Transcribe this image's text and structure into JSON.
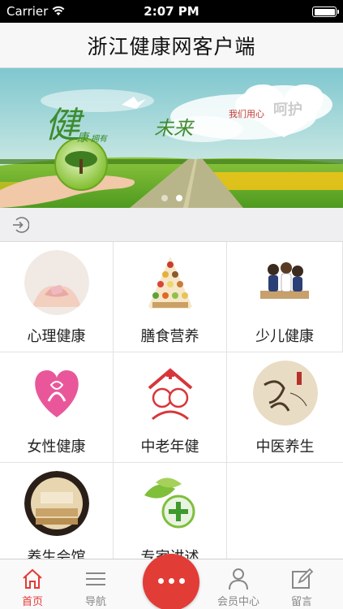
{
  "status_bar": {
    "carrier": "Carrier",
    "time": "2:07 PM"
  },
  "header": {
    "title": "浙江健康网客户端"
  },
  "banner": {
    "text_left_big": "健",
    "text_left_small": "康",
    "text_left_sub": "拥有",
    "text_future": "未来",
    "text_right_small": "我们用心",
    "text_right_big": "呵护",
    "page_count": 2,
    "active_page": 2
  },
  "notice": {
    "icon": "login-icon"
  },
  "categories": [
    {
      "label": "心理健康",
      "icon": "psychology-icon"
    },
    {
      "label": "膳食营养",
      "icon": "food-pyramid-icon"
    },
    {
      "label": "少儿健康",
      "icon": "children-icon"
    },
    {
      "label": "女性健康",
      "icon": "pink-ribbon-heart-icon"
    },
    {
      "label": "中老年健",
      "icon": "elderly-couple-icon"
    },
    {
      "label": "中医养生",
      "icon": "tcm-calligraphy-icon"
    },
    {
      "label": "养生会馆",
      "icon": "spa-hall-icon"
    },
    {
      "label": "专家讲述",
      "icon": "medical-cross-leaf-icon"
    }
  ],
  "tabs": [
    {
      "label": "首页",
      "icon": "home-icon",
      "active": true
    },
    {
      "label": "导航",
      "icon": "menu-icon",
      "active": false
    },
    {
      "label": "会员中心",
      "icon": "user-icon",
      "active": false
    },
    {
      "label": "留言",
      "icon": "edit-icon",
      "active": false
    }
  ],
  "colors": {
    "accent": "#e23c37",
    "active_tab": "#e43a36",
    "inactive_tab": "#888888"
  }
}
